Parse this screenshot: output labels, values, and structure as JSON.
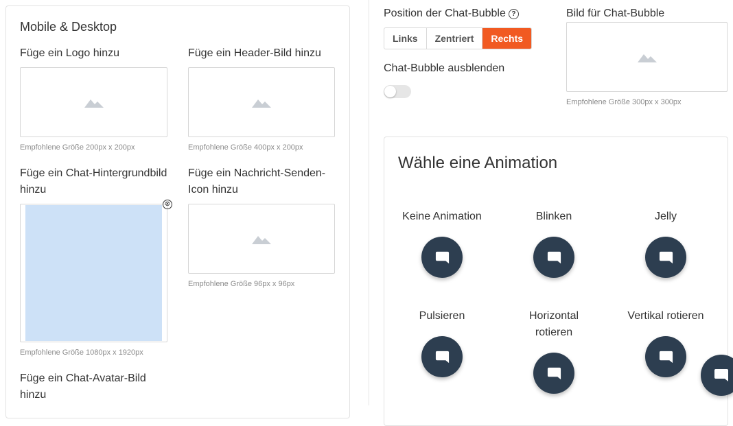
{
  "left": {
    "title": "Mobile & Desktop",
    "logo": {
      "label": "Füge ein Logo hinzu",
      "hint": "Empfohlene Größe 200px x 200px"
    },
    "header": {
      "label": "Füge ein Header-Bild hinzu",
      "hint": "Empfohlene Größe 400px x 200px"
    },
    "chat_bg": {
      "label_line1": "Füge ein Chat-Hintergrundbild",
      "label_line2": "hinzu",
      "hint": "Empfohlene Größe 1080px x 1920px",
      "remove_icon": "⊗"
    },
    "send_icon": {
      "label_line1": "Füge ein Nachricht-Senden-",
      "label_line2": "Icon hinzu",
      "hint": "Empfohlene Größe 96px x 96px"
    },
    "avatar": {
      "label_line1": "Füge ein Chat-Avatar-Bild",
      "label_line2": "hinzu"
    }
  },
  "right": {
    "position": {
      "label": "Position der Chat-Bubble",
      "help": "?",
      "options": [
        "Links",
        "Zentriert",
        "Rechts"
      ],
      "selected": "Rechts"
    },
    "hide": {
      "label": "Chat-Bubble ausblenden",
      "enabled": false
    },
    "bubble_image": {
      "label": "Bild für Chat-Bubble",
      "hint": "Empfohlene Größe 300px x 300px"
    },
    "animation": {
      "title": "Wähle eine Animation",
      "items": [
        {
          "label": "Keine Animation"
        },
        {
          "label": "Blinken"
        },
        {
          "label": "Jelly"
        },
        {
          "label": "Pulsieren"
        },
        {
          "label_line1": "Horizontal",
          "label_line2": "rotieren"
        },
        {
          "label": "Vertikal rotieren"
        }
      ]
    }
  },
  "colors": {
    "accent": "#f15a22",
    "bubble": "#2d3e50",
    "preview": "#cde1f7"
  }
}
